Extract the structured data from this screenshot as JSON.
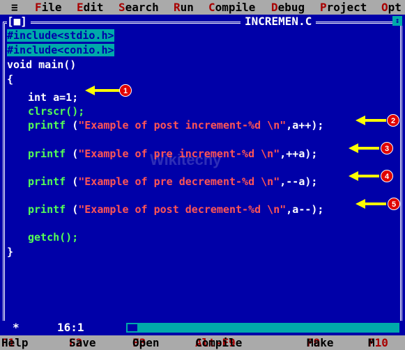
{
  "menu": {
    "system": "≡",
    "items": [
      {
        "hot": "F",
        "rest": "ile"
      },
      {
        "hot": "E",
        "rest": "dit"
      },
      {
        "hot": "S",
        "rest": "earch"
      },
      {
        "hot": "R",
        "rest": "un"
      },
      {
        "hot": "C",
        "rest": "ompile"
      },
      {
        "hot": "D",
        "rest": "ebug"
      },
      {
        "hot": "P",
        "rest": "roject"
      },
      {
        "hot": "O",
        "rest": "pt"
      }
    ]
  },
  "window": {
    "close": "[■]",
    "title": "INCREMEN.C",
    "mark": "↕"
  },
  "code": {
    "l1": "#include<stdio.h>",
    "l2": "#include<conio.h>",
    "l3a": "void",
    "l3b": " main()",
    "l4": "{",
    "l5a": "int",
    "l5b": " a=1;",
    "l6": "clrscr();",
    "l7a": "printf",
    "l7s": "\"Example of post increment-%d \\n\"",
    "l7e": ",a++);",
    "l8a": "printf",
    "l8s": "\"Example of pre increment-%d \\n\"",
    "l8e": ",++a);",
    "l9a": "printf",
    "l9s": "\"Example of pre decrement-%d \\n\"",
    "l9e": ",--a);",
    "l10a": "printf",
    "l10s": "\"Example of post decrement-%d \\n\"",
    "l10e": ",a--);",
    "l11": "getch();",
    "l12": "}",
    "paren": " ("
  },
  "markers": [
    "1",
    "2",
    "3",
    "4",
    "5"
  ],
  "status": {
    "star": "*",
    "position": "16:1"
  },
  "hints": [
    {
      "key": "F1",
      "label": " Help"
    },
    {
      "key": "F2",
      "label": " Save"
    },
    {
      "key": "F3",
      "label": " Open"
    },
    {
      "key": "Alt-F9",
      "label": " Compile"
    },
    {
      "key": "F9",
      "label": " Make"
    },
    {
      "key": "F10",
      "label": " M"
    }
  ],
  "colors": {
    "background": "#0000a8",
    "menu": "#aaaaaa",
    "hotkey": "#a80000",
    "string": "#ff5555",
    "function": "#55ff55",
    "arrow": "#ffff00",
    "marker": "#e00000"
  }
}
